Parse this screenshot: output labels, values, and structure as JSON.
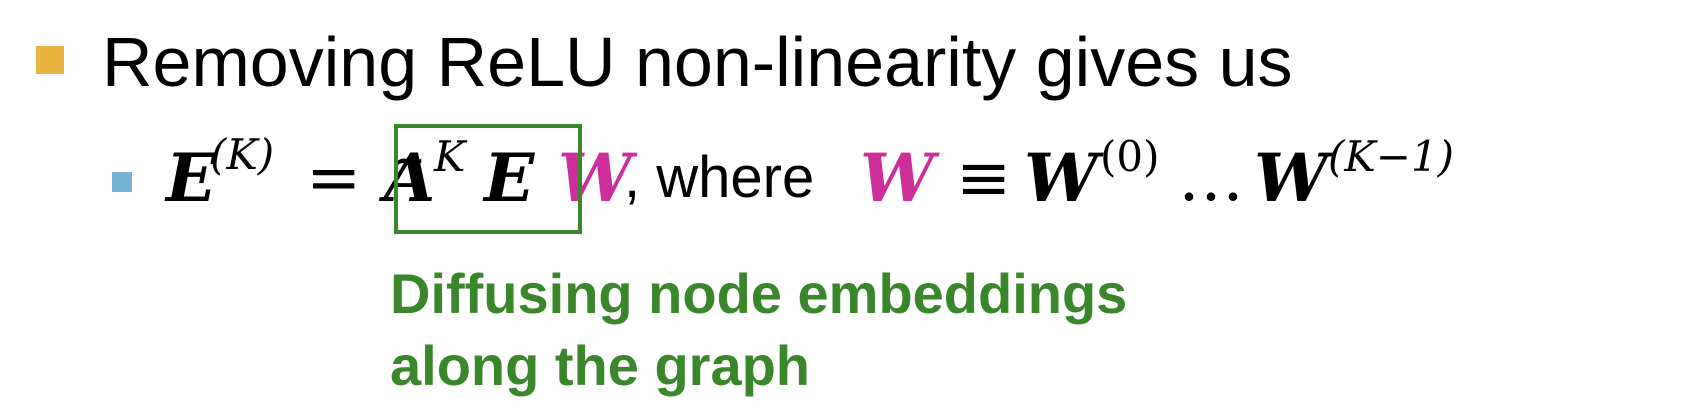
{
  "heading": {
    "text": "Removing ReLU non-linearity gives us",
    "bullet_color": "#e8b33e"
  },
  "equation": {
    "bullet_color": "#77b3d4",
    "lhs": "E",
    "lhs_superscript": "(K)",
    "equals": "=",
    "A": "A",
    "A_tilde": "~",
    "A_superscript": "K",
    "E": "E",
    "W": "W",
    "where_text": ", where",
    "equiv": "≡",
    "W0": "W",
    "W0_superscript": "(0)",
    "ellipsis": "…",
    "Wk": "W",
    "Wk_superscript": "(K−1)",
    "highlight_color": "#cc2f9a",
    "box_color": "#3a862a"
  },
  "caption": {
    "lines": [
      "Diffusing node embeddings",
      "along the graph"
    ],
    "color": "#3a862a"
  }
}
